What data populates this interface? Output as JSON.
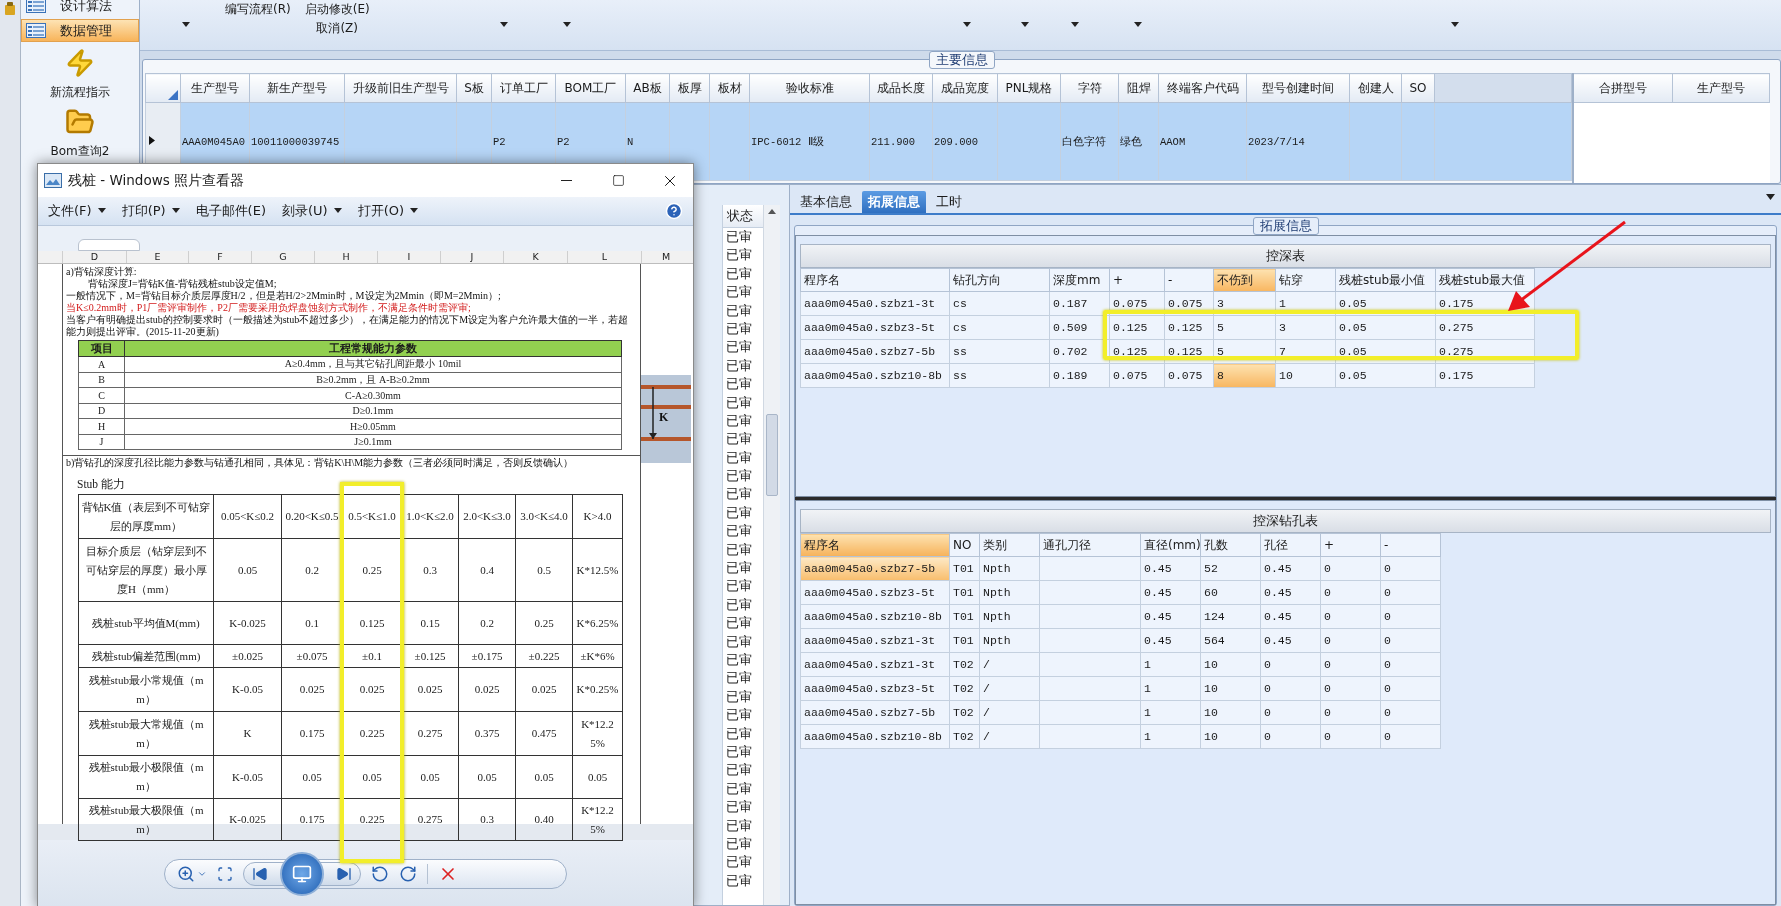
{
  "sidebar": {
    "items": [
      {
        "label": "设计算法",
        "selected": false
      },
      {
        "label": "数据管理",
        "selected": true
      }
    ],
    "shortcuts": [
      {
        "label": "新流程指示",
        "kind": "lightning"
      },
      {
        "label": "Bom查询2",
        "kind": "folder"
      }
    ]
  },
  "ribbon": {
    "commands": [
      {
        "label": "编写流程(R)"
      },
      {
        "label": "启动修改(E)"
      },
      {
        "label": "取消(Z)"
      }
    ]
  },
  "main_info": {
    "title": "主要信息",
    "columns": [
      "生产型号",
      "新生产型号",
      "升级前旧生产型号",
      "S板",
      "订单工厂",
      "BOM工厂",
      "AB板",
      "板厚",
      "板材",
      "验收标准",
      "成品长度",
      "成品宽度",
      "PNL规格",
      "字符",
      "阻焊",
      "终端客户代码",
      "型号创建时间",
      "创建人",
      "SO"
    ],
    "rows": [
      {
        "selected": true,
        "cells": [
          "AAA0M045A0",
          "10011000039745",
          null,
          null,
          "P2",
          "P2",
          "N",
          null,
          null,
          "IPC-6012 Ⅱ级",
          "211.900",
          "209.000",
          null,
          "白色字符",
          "绿色",
          "AAOM",
          "2023/7/14",
          null,
          null
        ]
      }
    ],
    "side_columns": [
      "合拼型号",
      "生产型号"
    ]
  },
  "list_panel": {
    "column": "状态",
    "rows": [
      "已审",
      "已审",
      "已审",
      "已审",
      "已审",
      "已审",
      "已审",
      "已审",
      "已审",
      "已审",
      "已审",
      "已审",
      "已审",
      "已审",
      "已审",
      "已审",
      "已审",
      "已审",
      "已审",
      "已审",
      "已审",
      "已审",
      "已审",
      "已审",
      "已审",
      "已审",
      "已审",
      "已审",
      "已审",
      "已审",
      "已审",
      "已审",
      "已审",
      "已审",
      "已审",
      "已审"
    ]
  },
  "detail": {
    "tabs": [
      {
        "label": "基本信息",
        "selected": false
      },
      {
        "label": "拓展信息",
        "selected": true
      },
      {
        "label": "工时",
        "selected": false
      }
    ],
    "group_title": "拓展信息",
    "depth_table": {
      "title": "控深表",
      "columns": [
        {
          "label": "程序名",
          "highlight": false
        },
        {
          "label": "钻孔方向",
          "highlight": false
        },
        {
          "label": "深度mm",
          "highlight": false
        },
        {
          "label": "+",
          "highlight": false
        },
        {
          "label": "-",
          "highlight": false
        },
        {
          "label": "不伤到",
          "highlight": true
        },
        {
          "label": "钻穿",
          "highlight": false
        },
        {
          "label": "残桩stub最小值",
          "highlight": false
        },
        {
          "label": "残桩stub最大值",
          "highlight": false
        }
      ],
      "rows": [
        {
          "annotated": false,
          "flagged": false,
          "cells": [
            "aaa0m045a0.szbz1-3t",
            "cs",
            "0.187",
            "0.075",
            "0.075",
            "3",
            "1",
            "0.05",
            "0.175"
          ]
        },
        {
          "annotated": true,
          "flagged": false,
          "cells": [
            "aaa0m045a0.szbz3-5t",
            "cs",
            "0.509",
            "0.125",
            "0.125",
            "5",
            "3",
            "0.05",
            "0.275"
          ]
        },
        {
          "annotated": true,
          "flagged": false,
          "cells": [
            "aaa0m045a0.szbz7-5b",
            "ss",
            "0.702",
            "0.125",
            "0.125",
            "5",
            "7",
            "0.05",
            "0.275"
          ]
        },
        {
          "annotated": false,
          "flagged": true,
          "cells": [
            "aaa0m045a0.szbz10-8b",
            "ss",
            "0.189",
            "0.075",
            "0.075",
            "8",
            "10",
            "0.05",
            "0.175"
          ]
        }
      ]
    },
    "drill_table": {
      "title": "控深钻孔表",
      "columns": [
        {
          "label": "程序名",
          "sorted": true
        },
        {
          "label": "NO",
          "sorted": false
        },
        {
          "label": "类别",
          "sorted": false
        },
        {
          "label": "通孔刀径",
          "sorted": false
        },
        {
          "label": "直径(mm)",
          "sorted": false
        },
        {
          "label": "孔数",
          "sorted": false
        },
        {
          "label": "孔径",
          "sorted": false
        },
        {
          "label": "+",
          "sorted": false
        },
        {
          "label": "-",
          "sorted": false
        }
      ],
      "rows": [
        {
          "selected": true,
          "cells": [
            "aaa0m045a0.szbz7-5b",
            "T01",
            "Npth",
            null,
            "0.45",
            "52",
            "0.45",
            "0",
            "0"
          ]
        },
        {
          "selected": false,
          "cells": [
            "aaa0m045a0.szbz3-5t",
            "T01",
            "Npth",
            null,
            "0.45",
            "60",
            "0.45",
            "0",
            "0"
          ]
        },
        {
          "selected": false,
          "cells": [
            "aaa0m045a0.szbz10-8b",
            "T01",
            "Npth",
            null,
            "0.45",
            "124",
            "0.45",
            "0",
            "0"
          ]
        },
        {
          "selected": false,
          "cells": [
            "aaa0m045a0.szbz1-3t",
            "T01",
            "Npth",
            null,
            "0.45",
            "564",
            "0.45",
            "0",
            "0"
          ]
        },
        {
          "selected": false,
          "cells": [
            "aaa0m045a0.szbz1-3t",
            "T02",
            "/",
            null,
            "1",
            "10",
            "0",
            "0",
            "0"
          ]
        },
        {
          "selected": false,
          "cells": [
            "aaa0m045a0.szbz3-5t",
            "T02",
            "/",
            null,
            "1",
            "10",
            "0",
            "0",
            "0"
          ]
        },
        {
          "selected": false,
          "cells": [
            "aaa0m045a0.szbz7-5b",
            "T02",
            "/",
            null,
            "1",
            "10",
            "0",
            "0",
            "0"
          ]
        },
        {
          "selected": false,
          "cells": [
            "aaa0m045a0.szbz10-8b",
            "T02",
            "/",
            null,
            "1",
            "10",
            "0",
            "0",
            "0"
          ]
        }
      ]
    }
  },
  "photo_viewer": {
    "title": "残桩 - Windows 照片查看器",
    "menu": [
      {
        "label": "文件(F)",
        "dropdown": true
      },
      {
        "label": "打印(P)",
        "dropdown": true
      },
      {
        "label": "电子邮件(E)",
        "dropdown": false
      },
      {
        "label": "刻录(U)",
        "dropdown": true
      },
      {
        "label": "打开(O)",
        "dropdown": true
      }
    ],
    "sheet": {
      "column_headers": [
        "D",
        "E",
        "F",
        "G",
        "H",
        "I",
        "J",
        "K",
        "L",
        "M"
      ],
      "notes": [
        {
          "kind": "normal",
          "text": "a)背钻深度计算:"
        },
        {
          "kind": "indented",
          "text": "背钻深度J=背钻K值-背钻残桩stub设定值M;"
        },
        {
          "kind": "normal",
          "text": "一般情况下，M=背钻目标介质层厚度H/2，但是若H/2>2Mmin时，M设定为2Mmin（即M=2Mmin）;"
        },
        {
          "kind": "warning",
          "text": "当K≤0.2mm时，P1厂需评审制作，P2厂需要采用负焊盘蚀刻方式制作，不满足条件时需评审;"
        },
        {
          "kind": "normal",
          "text": "当客户有明确提出stub的控制要求时（一般描述为stub不超过多少），在满足能力的情况下M设定为客户允许最大值的一半，若超能力则提出评审。(2015-11-20更新)"
        }
      ],
      "params_table": {
        "columns": [
          "项目",
          "工程常规能力参数"
        ],
        "rows": [
          [
            "A",
            "A≥0.4mm，且与其它钻孔间距最小 10mil"
          ],
          [
            "B",
            "B≥0.2mm，且 A-B≥0.2mm"
          ],
          [
            "C",
            "C-A≥0.30mm"
          ],
          [
            "D",
            "D≥0.1mm"
          ],
          [
            "H",
            "H≥0.05mm"
          ],
          [
            "J",
            "J≥0.1mm"
          ]
        ]
      },
      "note_b": "b)背钻孔的深度孔径比能力参数与钻通孔相同，具体见：背钻K\\H\\M能力参数（三者必须同时满足，否则反馈确认）",
      "stub_heading": "Stub 能力",
      "stub_table": {
        "columns": [
          {
            "label": "背钻K值（表层到不可钻穿层的厚度mm）",
            "annotated": false
          },
          {
            "label": "0.05<K≤0.2",
            "annotated": false
          },
          {
            "label": "0.20<K≤0.5",
            "annotated": false
          },
          {
            "label": "0.5<K≤1.0",
            "annotated": true
          },
          {
            "label": "1.0<K≤2.0",
            "annotated": false
          },
          {
            "label": "2.0<K≤3.0",
            "annotated": false
          },
          {
            "label": "3.0<K≤4.0",
            "annotated": false
          },
          {
            "label": "K>4.0",
            "annotated": false
          }
        ],
        "rows": [
          [
            "目标介质层（钻穿层到不可钻穿层的厚度）最小厚度H（mm）",
            "0.05",
            "0.2",
            "0.25",
            "0.3",
            "0.4",
            "0.5",
            "K*12.5%"
          ],
          [
            "残桩stub平均值M(mm)",
            "K-0.025",
            "0.1",
            "0.125",
            "0.15",
            "0.2",
            "0.25",
            "K*6.25%"
          ],
          [
            "残桩stub偏差范围(mm)",
            "±0.025",
            "±0.075",
            "±0.1",
            "±0.125",
            "±0.175",
            "±0.225",
            "±K*6%"
          ],
          [
            "残桩stub最小常规值（mm）",
            "K-0.05",
            "0.025",
            "0.025",
            "0.025",
            "0.025",
            "0.025",
            "K*0.25%"
          ],
          [
            "残桩stub最大常规值（mm）",
            "K",
            "0.175",
            "0.225",
            "0.275",
            "0.375",
            "0.475",
            "K*12.25%"
          ],
          [
            "残桩stub最小极限值（mm）",
            "K-0.05",
            "0.05",
            "0.05",
            "0.05",
            "0.05",
            "0.05",
            "0.05"
          ],
          [
            "残桩stub最大极限值（mm）",
            "K-0.025",
            "0.175",
            "0.225",
            "0.275",
            "0.3",
            "0.40",
            "K*12.25%"
          ]
        ]
      },
      "figure_label": "K"
    }
  }
}
